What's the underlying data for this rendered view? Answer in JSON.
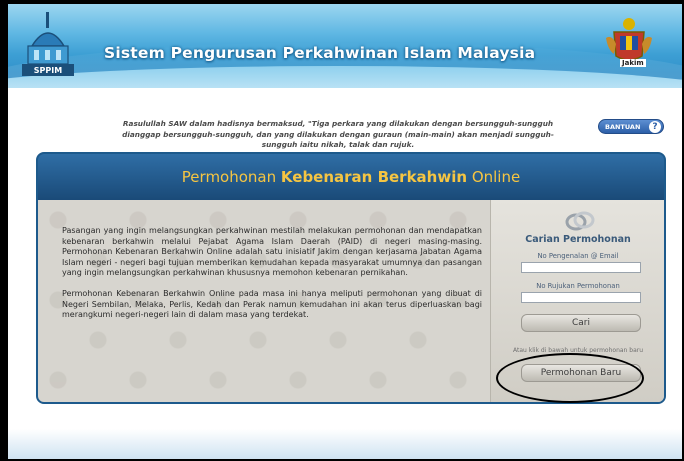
{
  "header": {
    "title": "Sistem Pengurusan Perkahwinan Islam Malaysia",
    "left_logo_text": "SPPIM",
    "crest_label": "Jakim"
  },
  "quote": "Rasulullah SAW dalam hadisnya bermaksud, \"Tiga perkara yang dilakukan dengan bersungguh-sungguh dianggap bersungguh-sungguh, dan yang dilakukan dengan guraun (main-main) akan menjadi sungguh-sungguh iaitu nikah, talak dan rujuk.",
  "help_button": {
    "label": "BANTUAN",
    "icon": "?"
  },
  "panel": {
    "title_prefix": "Permohonan",
    "title_bold": "Kebenaran Berkahwin",
    "title_suffix": "Online",
    "paragraphs": [
      "Pasangan yang ingin melangsungkan perkahwinan mestilah melakukan permohonan dan mendapatkan kebenaran berkahwin melalui Pejabat Agama Islam Daerah (PAID) di negeri masing-masing. Permohonan Kebenaran Berkahwin Online adalah satu inisiatif Jakim dengan kerjasama Jabatan Agama Islam negeri - negeri bagi tujuan memberikan kemudahan kepada masyarakat umumnya dan pasangan yang ingin melangsungkan perkahwinan khususnya memohon kebenaran pernikahan.",
      "Permohonan Kebenaran Berkahwin Online pada masa ini hanya meliputi permohonan yang dibuat di Negeri Sembilan, Melaka, Perlis, Kedah dan Perak namun kemudahan ini akan terus diperluaskan bagi merangkumi negeri-negeri lain di dalam masa yang terdekat."
    ]
  },
  "search": {
    "title": "Carian Permohonan",
    "id_label": "No Pengenalan @ Email",
    "id_value": "",
    "ref_label": "No Rujukan Permohonan",
    "ref_value": "",
    "search_button": "Cari",
    "note": "Atau klik di bawah untuk permohonan baru",
    "new_button": "Permohonan Baru"
  },
  "colors": {
    "title_accent": "#f5c542",
    "panel_bg": "#1f4f7e",
    "header_blue": "#3d9fd4"
  }
}
